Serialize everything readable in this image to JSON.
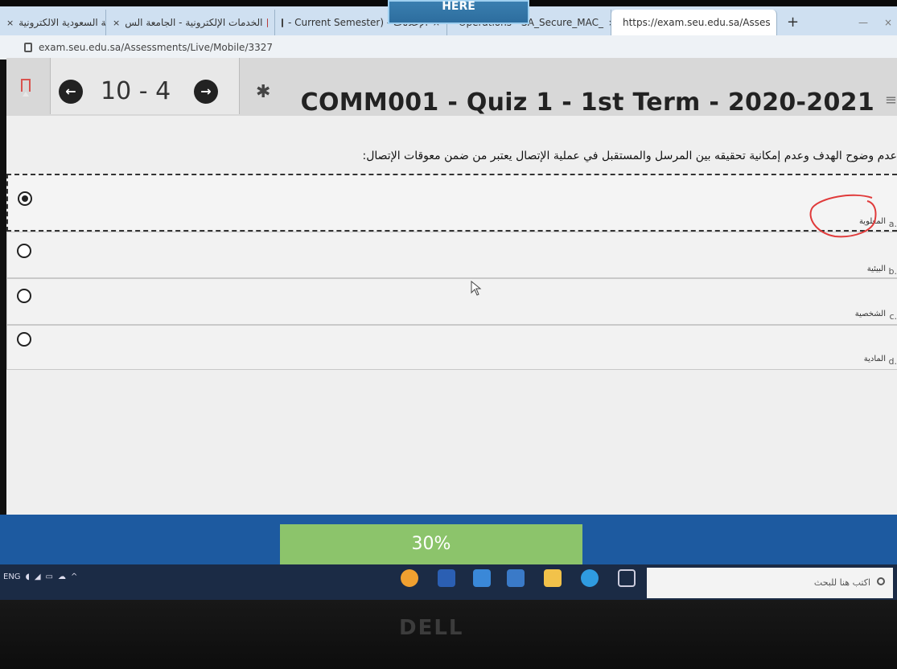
{
  "overlay": {
    "banner_text": "HERE"
  },
  "browser": {
    "tabs": [
      {
        "label": "الجامعة السعودية الالكترونية",
        "favicon": "building-icon",
        "active": false
      },
      {
        "label": "الخدمات الإلكترونية - الجامعة الس",
        "favicon": "app-icon",
        "active": false
      },
      {
        "label": "- Current Semester) - الإعلانات",
        "favicon": "app-icon",
        "active": false
      },
      {
        "label": "Operations - SA_Secure_MAC_",
        "favicon": "globe-icon",
        "active": false
      },
      {
        "label": "https://exam.seu.edu.sa/Asses",
        "favicon": "globe-icon",
        "active": true
      }
    ],
    "new_tab": "+",
    "minimize": "—",
    "close_sym": "×",
    "url": "exam.seu.edu.sa/Assessments/Live/Mobile/3327"
  },
  "toolbar": {
    "prev_symbol": "←",
    "next_symbol": "→",
    "counter": "10 - 4",
    "settings_symbol": "✱",
    "title": "COMM001 - Quiz 1 - 1st Term - 2020-2021",
    "menu_symbol": "≡"
  },
  "question": {
    "text": "عدم وضوح الهدف وعدم إمكانية تحقيقه بين المرسل والمستقبل في عملية الإتصال يعتبر من ضمن معوقات الإتصال:",
    "options": [
      {
        "letter": "a.",
        "label": "المعلوية",
        "selected": true
      },
      {
        "letter": "b.",
        "label": "البيئية",
        "selected": false
      },
      {
        "letter": "c.",
        "label": "الشخصية",
        "selected": false
      },
      {
        "letter": "d.",
        "label": "المادية",
        "selected": false
      }
    ]
  },
  "progress": {
    "value": 0.3,
    "label": "30%"
  },
  "taskbar": {
    "tray_text": "ENG",
    "search_placeholder": "اكتب هنا للبحث"
  },
  "bezel": {
    "brand": "DELL"
  },
  "colors": {
    "progress_fill": "#8cc46b",
    "footer_blue": "#1d5aa0",
    "annotation_red": "#e03a3a"
  }
}
